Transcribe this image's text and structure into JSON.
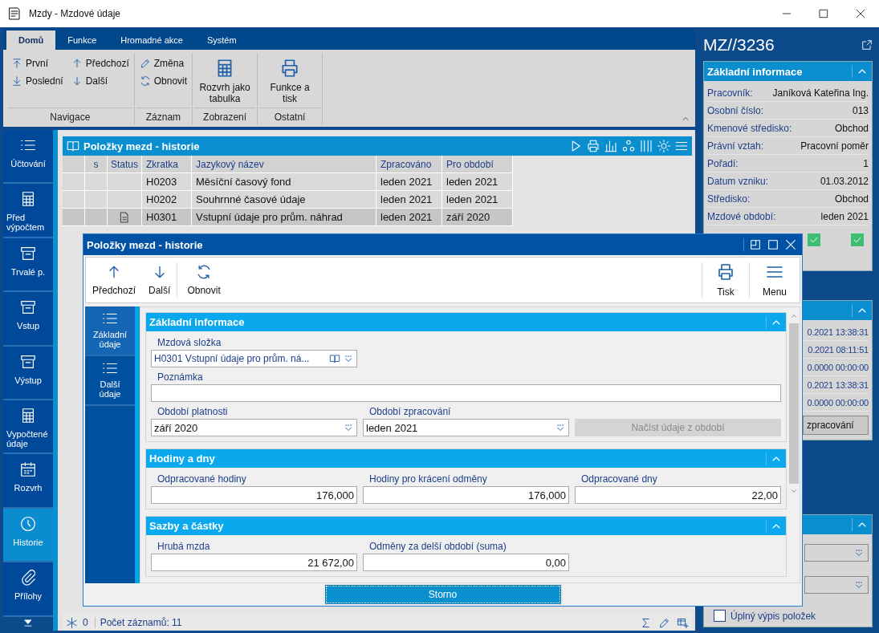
{
  "window": {
    "title": "Mzdy - Mzdové údaje"
  },
  "ribbon": {
    "tabs": [
      {
        "label": "Domů",
        "selected": true
      },
      {
        "label": "Funkce",
        "selected": false
      },
      {
        "label": "Hromadné akce",
        "selected": false
      },
      {
        "label": "Systém",
        "selected": false
      }
    ],
    "groups": [
      {
        "label": "Navigace",
        "kind": "small",
        "buttons": [
          {
            "label": "První"
          },
          {
            "label": "Poslední"
          },
          {
            "label": "Předchozí"
          },
          {
            "label": "Další"
          }
        ]
      },
      {
        "label": "Záznam",
        "kind": "small",
        "buttons": [
          {
            "label": "Změna"
          },
          {
            "label": "Obnovit"
          }
        ]
      },
      {
        "label": "Zobrazení",
        "kind": "large",
        "buttons": [
          {
            "label": "Rozvrh jako tabulka"
          }
        ]
      },
      {
        "label": "Ostatní",
        "kind": "large",
        "buttons": [
          {
            "label": "Funkce a tisk"
          }
        ]
      }
    ]
  },
  "sidebar": {
    "items": [
      {
        "label": "Účtování",
        "selected": false
      },
      {
        "label": "Před výpočtem",
        "selected": false
      },
      {
        "label": "Trvalé p.",
        "selected": false
      },
      {
        "label": "Vstup",
        "selected": false
      },
      {
        "label": "Výstup",
        "selected": false
      },
      {
        "label": "Vypočtené údaje",
        "selected": false
      },
      {
        "label": "Rozvrh",
        "selected": false
      },
      {
        "label": "Historie",
        "selected": true
      },
      {
        "label": "Přílohy",
        "selected": false
      }
    ]
  },
  "table": {
    "title": "Položky mezd - historie",
    "columns": [
      "s",
      "Status",
      "Zkratka",
      "Jazykový název",
      "Zpracováno",
      "Pro období"
    ],
    "rows": [
      {
        "code": "H0203",
        "name": "Měsíční časový fond",
        "processed": "leden 2021",
        "period": "leden 2021",
        "has_status": false,
        "selected": false
      },
      {
        "code": "H0202",
        "name": "Souhrnné časové údaje",
        "processed": "leden 2021",
        "period": "leden 2021",
        "has_status": false,
        "selected": false
      },
      {
        "code": "H0301",
        "name": "Vstupní údaje pro prům. náhrad",
        "processed": "leden 2021",
        "period": "září 2020",
        "has_status": true,
        "selected": true
      }
    ]
  },
  "status_bar": {
    "count": "0",
    "records": "Počet záznamů: 11"
  },
  "record_panel": {
    "title": "MZ//3236",
    "info": {
      "title": "Základní informace",
      "rows": [
        {
          "label": "Pracovník:",
          "value": "Janíková Kateřina Ing."
        },
        {
          "label": "Osobní číslo:",
          "value": "013"
        },
        {
          "label": "Kmenové středisko:",
          "value": "Obchod"
        },
        {
          "label": "Právní vztah:",
          "value": "Pracovní poměr"
        },
        {
          "label": "Pořadí:",
          "value": "1"
        },
        {
          "label": "Datum vzniku:",
          "value": "01.03.2012"
        },
        {
          "label": "Středisko:",
          "value": "Obchod"
        },
        {
          "label": "Mzdové období:",
          "value": "leden 2021"
        }
      ],
      "checks": [
        {
          "checked": true
        },
        {
          "checked": true
        }
      ]
    },
    "dates": {
      "rows": [
        "0.2021 13:38:31",
        "0.2021 08:11:51",
        "0.0000 00:00:00",
        "0.2021 13:38:31",
        "0.0000 00:00:00"
      ],
      "button": "zpracování"
    },
    "options": {
      "checkbox": {
        "label": "Úplný výpis položek",
        "checked": false
      }
    }
  },
  "dialog": {
    "title": "Položky mezd - historie",
    "toolbar_left": [
      {
        "label": "Předchozí"
      },
      {
        "label": "Další"
      },
      {
        "label": "Obnovit"
      }
    ],
    "toolbar_right": [
      {
        "label": "Tisk"
      },
      {
        "label": "Menu"
      }
    ],
    "nav": [
      {
        "label": "Základní údaje",
        "selected": true
      },
      {
        "label": "Další údaje",
        "selected": false
      }
    ],
    "sections": [
      {
        "title": "Základní informace",
        "fields": [
          {
            "kind": "lookup",
            "label": "Mzdová složka",
            "value": "H0301 Vstupní údaje pro prům. ná..."
          },
          {
            "kind": "text",
            "label": "Poznámka"
          },
          {
            "kind": "dropdown",
            "label": "Období platnosti",
            "value": "září 2020"
          },
          {
            "kind": "dropdown",
            "label": "Období zpracování",
            "value": "leden 2021"
          },
          {
            "kind": "button",
            "value": "Načíst údaje z období",
            "disabled": true
          }
        ]
      },
      {
        "title": "Hodiny a dny",
        "fields": [
          {
            "kind": "number",
            "label": "Odpracované hodiny",
            "value": "176,000"
          },
          {
            "kind": "number",
            "label": "Hodiny pro krácení odměny",
            "value": "176,000"
          },
          {
            "kind": "number",
            "label": "Odpracované dny",
            "value": "22,00"
          }
        ]
      },
      {
        "title": "Sazby a částky",
        "fields": [
          {
            "kind": "number",
            "label": "Hrubá mzda",
            "value": "21 672,00"
          },
          {
            "kind": "number",
            "label": "Odměny za delší období (suma)",
            "value": "0,00"
          }
        ]
      }
    ],
    "cancel_button": "Storno"
  }
}
